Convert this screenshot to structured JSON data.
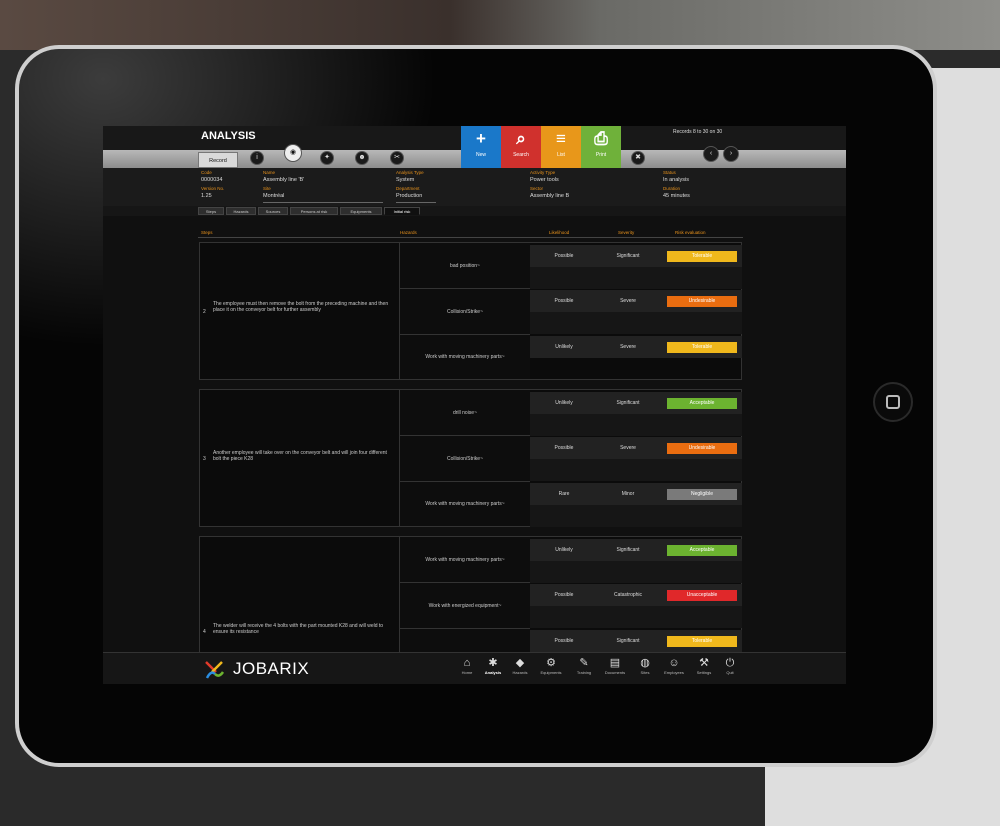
{
  "app": {
    "title": "ANALYSIS",
    "records": "Records 8 to 30 on 30",
    "tab_record": "Record"
  },
  "toolbar": {
    "icons": [
      {
        "icon": "info-icon",
        "label": "Info"
      },
      {
        "icon": "hazards-icon",
        "label": "Hazards"
      },
      {
        "icon": "mask-icon",
        "label": "Notes"
      },
      {
        "icon": "people-icon",
        "label": "Persons"
      },
      {
        "icon": "attach-icon",
        "label": "Attach"
      }
    ],
    "big_buttons": [
      {
        "label": "New",
        "glyph": "+",
        "color": "#1a78c9"
      },
      {
        "label": "Search",
        "glyph": "⌕",
        "color": "#d0312d"
      },
      {
        "label": "List",
        "glyph": "≡",
        "color": "#e8971a"
      },
      {
        "label": "Print",
        "glyph": "⎙",
        "color": "#6fb13a"
      }
    ],
    "delete_label": "Delete",
    "prev_label": "Previous",
    "next_label": "Next"
  },
  "fields": {
    "code_label": "Code",
    "code": "0000034",
    "name_label": "Name",
    "name": "Assembly line 'B'",
    "analysis_type_label": "Analysis Type",
    "analysis_type": "System",
    "activity_type_label": "Activity Type",
    "activity_type": "Power tools",
    "status_label": "Status",
    "status": "In analysis",
    "version_label": "Version No.",
    "version": "1.25",
    "site_label": "Site",
    "site": "Montréal",
    "department_label": "Department",
    "department": "Production",
    "sector_label": "Sector",
    "sector": "Assembly line B",
    "duration_label": "Duration",
    "duration": "45 minutes"
  },
  "subtabs": [
    "Steps",
    "Hazards",
    "Sources",
    "Persons at risk",
    "Equipments",
    "Initial risk"
  ],
  "columns": {
    "steps": "Steps",
    "hazards": "Hazards",
    "likelihood": "Likelihood",
    "severity": "Severity",
    "risk": "Risk evaluation"
  },
  "groups": [
    {
      "num": "2",
      "text": "The employee must then remove the bolt from the preceding machine and then place it on the conveyor belt for further assembly",
      "hazards": [
        {
          "hazard": "bad position~",
          "likelihood": "Possible",
          "severity": "Significant",
          "risk": "Tolerable",
          "color": "#f0b81c"
        },
        {
          "hazard": "Collision/Strike~",
          "likelihood": "Possible",
          "severity": "Severe",
          "risk": "Undesirable",
          "color": "#ea6d10"
        },
        {
          "hazard": "Work with moving machinery parts~",
          "likelihood": "Unlikely",
          "severity": "Severe",
          "risk": "Tolerable",
          "color": "#f0b81c"
        }
      ]
    },
    {
      "num": "3",
      "text": "Another employee will take over on the conveyor belt and will join four different bolt the piece K28",
      "hazards": [
        {
          "hazard": "drill noise~",
          "likelihood": "Unlikely",
          "severity": "Significant",
          "risk": "Acceptable",
          "color": "#6cb330"
        },
        {
          "hazard": "Collision/Strike~",
          "likelihood": "Possible",
          "severity": "Severe",
          "risk": "Undesirable",
          "color": "#ea6d10"
        },
        {
          "hazard": "Work with moving machinery parts~",
          "likelihood": "Rare",
          "severity": "Minor",
          "risk": "Negligible",
          "color": "#7a7a7a"
        }
      ]
    },
    {
      "num": "4",
      "text": "The welder will receive the 4 bolts with the part mounted K28 and will weld to ensure its resistance",
      "hazards": [
        {
          "hazard": "Work with moving machinery parts~",
          "likelihood": "Unlikely",
          "severity": "Significant",
          "risk": "Acceptable",
          "color": "#6cb330"
        },
        {
          "hazard": "Work with energized equipment~",
          "likelihood": "Possible",
          "severity": "Catastrophic",
          "risk": "Unacceptable",
          "color": "#e0282a"
        },
        {
          "hazard": "",
          "likelihood": "Possible",
          "severity": "Significant",
          "risk": "Tolerable",
          "color": "#f0b81c"
        }
      ]
    }
  ],
  "footer": {
    "brand": "JOBARIX",
    "nav": [
      {
        "label": "Home",
        "icon": "home-icon",
        "glyph": "⌂"
      },
      {
        "label": "Analysis",
        "icon": "analysis-icon",
        "glyph": "✱",
        "active": true
      },
      {
        "label": "Hazards",
        "icon": "hazard-icon",
        "glyph": "◆"
      },
      {
        "label": "Equipments",
        "icon": "equipment-icon",
        "glyph": "⚙"
      },
      {
        "label": "Training",
        "icon": "training-icon",
        "glyph": "✎"
      },
      {
        "label": "Documents",
        "icon": "documents-icon",
        "glyph": "▤"
      },
      {
        "label": "Sites",
        "icon": "sites-icon",
        "glyph": "◍"
      },
      {
        "label": "Employees",
        "icon": "employees-icon",
        "glyph": "☺"
      },
      {
        "label": "Settings",
        "icon": "settings-icon",
        "glyph": "⚒"
      },
      {
        "label": "Quit",
        "icon": "quit-icon",
        "glyph": "⏻"
      }
    ]
  }
}
